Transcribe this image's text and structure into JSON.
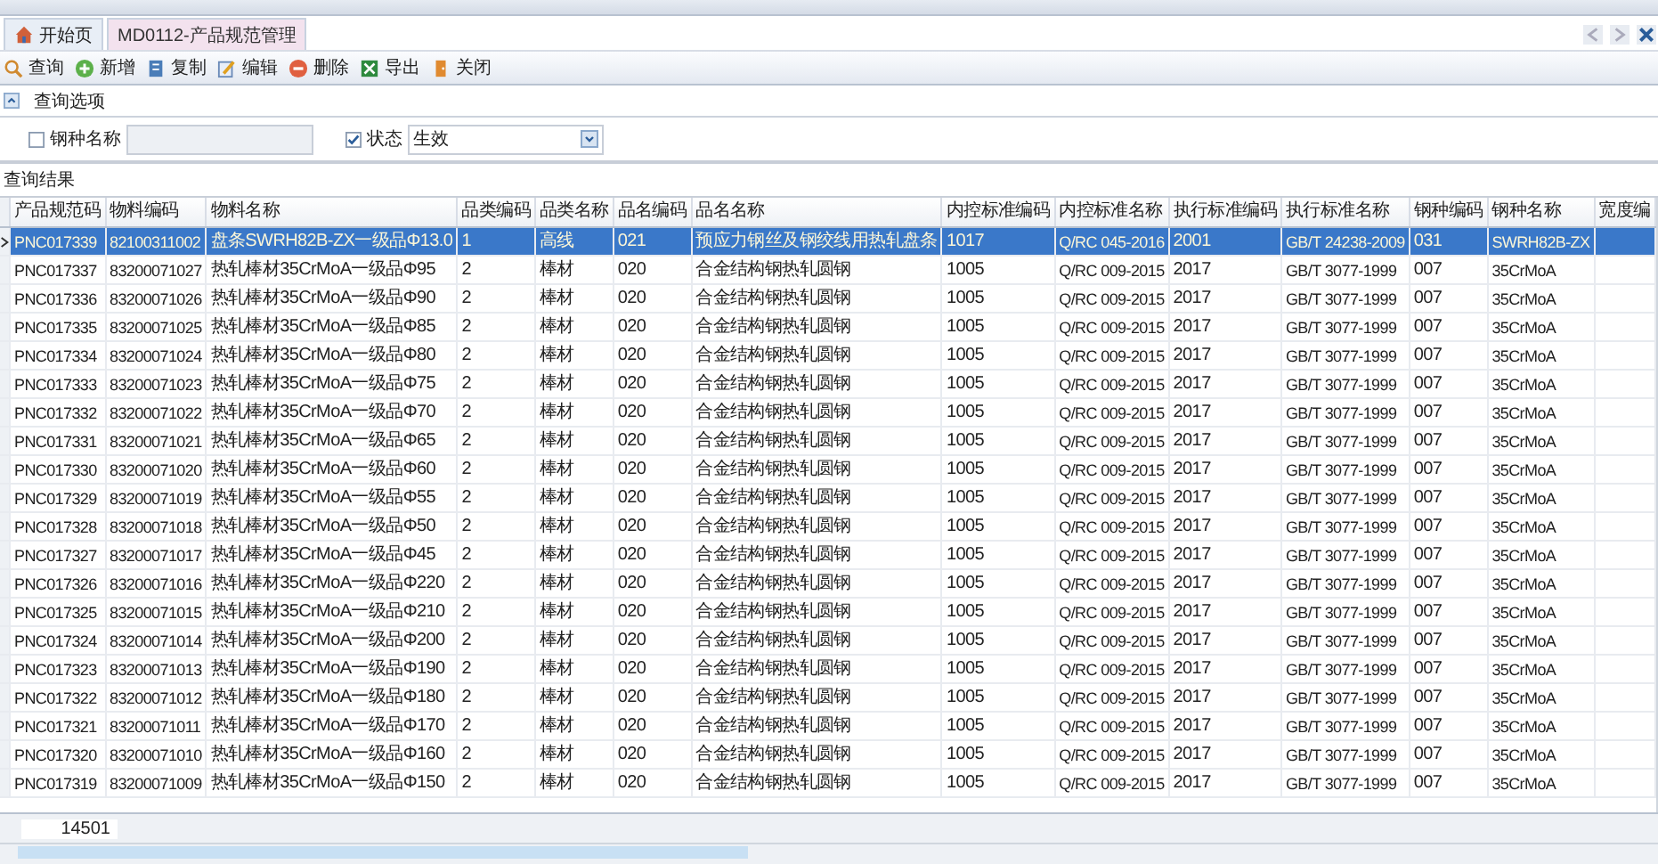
{
  "tabs": [
    {
      "label": "开始页",
      "kind": "home",
      "selected": false
    },
    {
      "label": "MD0112-产品规范管理",
      "kind": "page",
      "selected": true
    }
  ],
  "toolbar": [
    {
      "label": "查询",
      "kind": "search"
    },
    {
      "label": "新增",
      "kind": "add"
    },
    {
      "label": "复制",
      "kind": "copy"
    },
    {
      "label": "编辑",
      "kind": "edit"
    },
    {
      "label": "删除",
      "kind": "delete"
    },
    {
      "label": "导出",
      "kind": "export"
    },
    {
      "label": "关闭",
      "kind": "close"
    }
  ],
  "query_options": {
    "title": "查询选项",
    "expanded": true,
    "filters": [
      {
        "label": "钢种名称",
        "checked": false,
        "kind": "text"
      },
      {
        "label": "状态",
        "checked": true,
        "kind": "select",
        "value": "生效"
      }
    ]
  },
  "results": {
    "title": "查询结果",
    "columns": [
      "产品规范码",
      "物料编码",
      "物料名称",
      "品类编码",
      "品类名称",
      "品名编码",
      "品名名称",
      "内控标准编码",
      "内控标准名称",
      "执行标准编码",
      "执行标准名称",
      "钢种编码",
      "钢种名称",
      "宽度编"
    ],
    "rows": [
      {
        "selected": true,
        "cells": [
          "PNC017339",
          "82100311002",
          "盘条SWRH82B-ZX一级品Φ13.0",
          "1",
          "高线",
          "021",
          "预应力钢丝及钢绞线用热轧盘条",
          "1017",
          "Q/RC 045-2016",
          "2001",
          "GB/T 24238-2009",
          "031",
          "SWRH82B-ZX",
          ""
        ]
      },
      {
        "selected": false,
        "cells": [
          "PNC017337",
          "83200071027",
          "热轧棒材35CrMoA一级品Φ95",
          "2",
          "棒材",
          "020",
          "合金结构钢热轧圆钢",
          "1005",
          "Q/RC 009-2015",
          "2017",
          "GB/T 3077-1999",
          "007",
          "35CrMoA",
          ""
        ]
      },
      {
        "selected": false,
        "cells": [
          "PNC017336",
          "83200071026",
          "热轧棒材35CrMoA一级品Φ90",
          "2",
          "棒材",
          "020",
          "合金结构钢热轧圆钢",
          "1005",
          "Q/RC 009-2015",
          "2017",
          "GB/T 3077-1999",
          "007",
          "35CrMoA",
          ""
        ]
      },
      {
        "selected": false,
        "cells": [
          "PNC017335",
          "83200071025",
          "热轧棒材35CrMoA一级品Φ85",
          "2",
          "棒材",
          "020",
          "合金结构钢热轧圆钢",
          "1005",
          "Q/RC 009-2015",
          "2017",
          "GB/T 3077-1999",
          "007",
          "35CrMoA",
          ""
        ]
      },
      {
        "selected": false,
        "cells": [
          "PNC017334",
          "83200071024",
          "热轧棒材35CrMoA一级品Φ80",
          "2",
          "棒材",
          "020",
          "合金结构钢热轧圆钢",
          "1005",
          "Q/RC 009-2015",
          "2017",
          "GB/T 3077-1999",
          "007",
          "35CrMoA",
          ""
        ]
      },
      {
        "selected": false,
        "cells": [
          "PNC017333",
          "83200071023",
          "热轧棒材35CrMoA一级品Φ75",
          "2",
          "棒材",
          "020",
          "合金结构钢热轧圆钢",
          "1005",
          "Q/RC 009-2015",
          "2017",
          "GB/T 3077-1999",
          "007",
          "35CrMoA",
          ""
        ]
      },
      {
        "selected": false,
        "cells": [
          "PNC017332",
          "83200071022",
          "热轧棒材35CrMoA一级品Φ70",
          "2",
          "棒材",
          "020",
          "合金结构钢热轧圆钢",
          "1005",
          "Q/RC 009-2015",
          "2017",
          "GB/T 3077-1999",
          "007",
          "35CrMoA",
          ""
        ]
      },
      {
        "selected": false,
        "cells": [
          "PNC017331",
          "83200071021",
          "热轧棒材35CrMoA一级品Φ65",
          "2",
          "棒材",
          "020",
          "合金结构钢热轧圆钢",
          "1005",
          "Q/RC 009-2015",
          "2017",
          "GB/T 3077-1999",
          "007",
          "35CrMoA",
          ""
        ]
      },
      {
        "selected": false,
        "cells": [
          "PNC017330",
          "83200071020",
          "热轧棒材35CrMoA一级品Φ60",
          "2",
          "棒材",
          "020",
          "合金结构钢热轧圆钢",
          "1005",
          "Q/RC 009-2015",
          "2017",
          "GB/T 3077-1999",
          "007",
          "35CrMoA",
          ""
        ]
      },
      {
        "selected": false,
        "cells": [
          "PNC017329",
          "83200071019",
          "热轧棒材35CrMoA一级品Φ55",
          "2",
          "棒材",
          "020",
          "合金结构钢热轧圆钢",
          "1005",
          "Q/RC 009-2015",
          "2017",
          "GB/T 3077-1999",
          "007",
          "35CrMoA",
          ""
        ]
      },
      {
        "selected": false,
        "cells": [
          "PNC017328",
          "83200071018",
          "热轧棒材35CrMoA一级品Φ50",
          "2",
          "棒材",
          "020",
          "合金结构钢热轧圆钢",
          "1005",
          "Q/RC 009-2015",
          "2017",
          "GB/T 3077-1999",
          "007",
          "35CrMoA",
          ""
        ]
      },
      {
        "selected": false,
        "cells": [
          "PNC017327",
          "83200071017",
          "热轧棒材35CrMoA一级品Φ45",
          "2",
          "棒材",
          "020",
          "合金结构钢热轧圆钢",
          "1005",
          "Q/RC 009-2015",
          "2017",
          "GB/T 3077-1999",
          "007",
          "35CrMoA",
          ""
        ]
      },
      {
        "selected": false,
        "cells": [
          "PNC017326",
          "83200071016",
          "热轧棒材35CrMoA一级品Φ220",
          "2",
          "棒材",
          "020",
          "合金结构钢热轧圆钢",
          "1005",
          "Q/RC 009-2015",
          "2017",
          "GB/T 3077-1999",
          "007",
          "35CrMoA",
          ""
        ]
      },
      {
        "selected": false,
        "cells": [
          "PNC017325",
          "83200071015",
          "热轧棒材35CrMoA一级品Φ210",
          "2",
          "棒材",
          "020",
          "合金结构钢热轧圆钢",
          "1005",
          "Q/RC 009-2015",
          "2017",
          "GB/T 3077-1999",
          "007",
          "35CrMoA",
          ""
        ]
      },
      {
        "selected": false,
        "cells": [
          "PNC017324",
          "83200071014",
          "热轧棒材35CrMoA一级品Φ200",
          "2",
          "棒材",
          "020",
          "合金结构钢热轧圆钢",
          "1005",
          "Q/RC 009-2015",
          "2017",
          "GB/T 3077-1999",
          "007",
          "35CrMoA",
          ""
        ]
      },
      {
        "selected": false,
        "cells": [
          "PNC017323",
          "83200071013",
          "热轧棒材35CrMoA一级品Φ190",
          "2",
          "棒材",
          "020",
          "合金结构钢热轧圆钢",
          "1005",
          "Q/RC 009-2015",
          "2017",
          "GB/T 3077-1999",
          "007",
          "35CrMoA",
          ""
        ]
      },
      {
        "selected": false,
        "cells": [
          "PNC017322",
          "83200071012",
          "热轧棒材35CrMoA一级品Φ180",
          "2",
          "棒材",
          "020",
          "合金结构钢热轧圆钢",
          "1005",
          "Q/RC 009-2015",
          "2017",
          "GB/T 3077-1999",
          "007",
          "35CrMoA",
          ""
        ]
      },
      {
        "selected": false,
        "cells": [
          "PNC017321",
          "83200071011",
          "热轧棒材35CrMoA一级品Φ170",
          "2",
          "棒材",
          "020",
          "合金结构钢热轧圆钢",
          "1005",
          "Q/RC 009-2015",
          "2017",
          "GB/T 3077-1999",
          "007",
          "35CrMoA",
          ""
        ]
      },
      {
        "selected": false,
        "cells": [
          "PNC017320",
          "83200071010",
          "热轧棒材35CrMoA一级品Φ160",
          "2",
          "棒材",
          "020",
          "合金结构钢热轧圆钢",
          "1005",
          "Q/RC 009-2015",
          "2017",
          "GB/T 3077-1999",
          "007",
          "35CrMoA",
          ""
        ]
      },
      {
        "selected": false,
        "cells": [
          "PNC017319",
          "83200071009",
          "热轧棒材35CrMoA一级品Φ150",
          "2",
          "棒材",
          "020",
          "合金结构钢热轧圆钢",
          "1005",
          "Q/RC 009-2015",
          "2017",
          "GB/T 3077-1999",
          "007",
          "35CrMoA",
          ""
        ]
      }
    ],
    "total": "14501"
  }
}
